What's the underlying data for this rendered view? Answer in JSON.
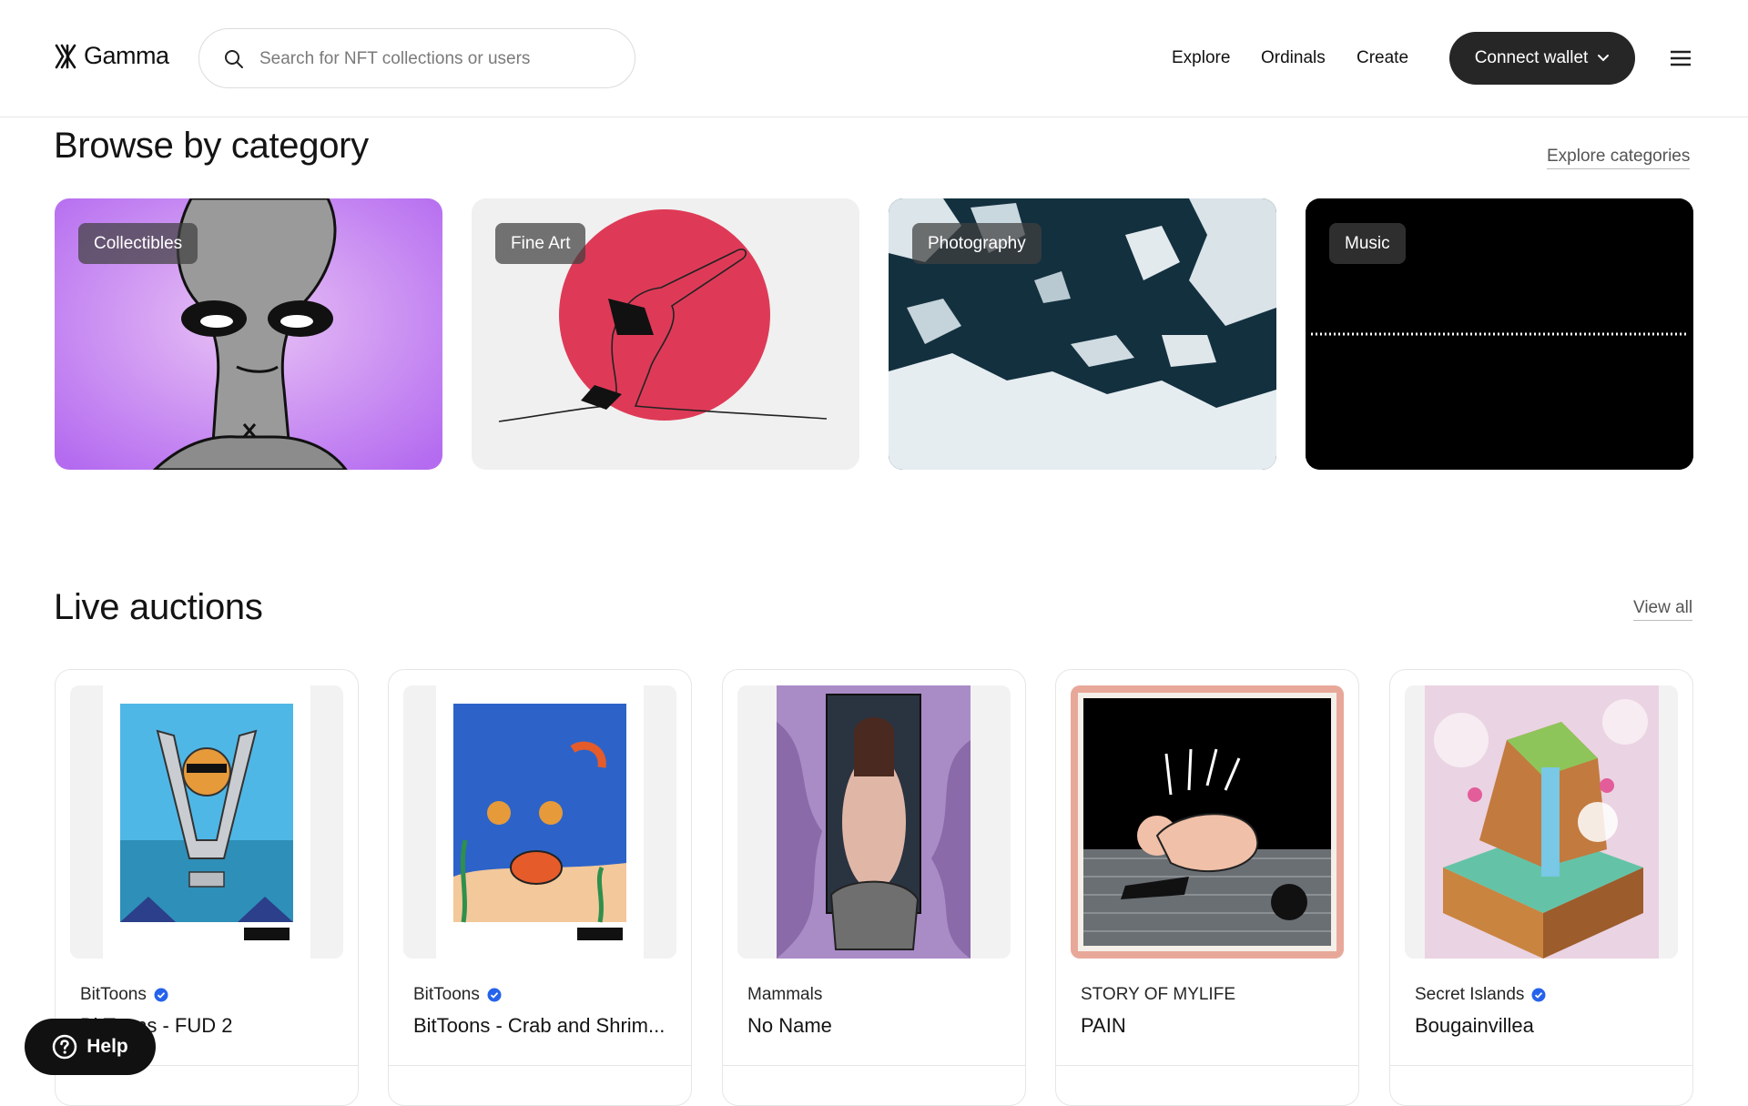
{
  "header": {
    "logo_text": "Gamma",
    "search": {
      "placeholder": "Search for NFT collections or users",
      "value": ""
    },
    "nav": [
      {
        "label": "Explore"
      },
      {
        "label": "Ordinals"
      },
      {
        "label": "Create"
      }
    ],
    "connect_label": "Connect wallet"
  },
  "categories": {
    "title": "Browse by category",
    "link": "Explore categories",
    "items": [
      {
        "label": "Collectibles"
      },
      {
        "label": "Fine Art"
      },
      {
        "label": "Photography"
      },
      {
        "label": "Music"
      }
    ]
  },
  "auctions": {
    "title": "Live auctions",
    "link": "View all",
    "items": [
      {
        "collection": "BitToons",
        "verified": true,
        "name": "BitToons - FUD 2"
      },
      {
        "collection": "BitToons",
        "verified": true,
        "name": "BitToons - Crab and Shrim..."
      },
      {
        "collection": "Mammals",
        "verified": false,
        "name": "No Name"
      },
      {
        "collection": "STORY OF MYLIFE",
        "verified": false,
        "name": "PAIN"
      },
      {
        "collection": "Secret Islands",
        "verified": true,
        "name": "Bougainvillea"
      }
    ]
  },
  "help_label": "Help",
  "colors": {
    "accent_dark": "#262626",
    "verified_blue": "#2563eb"
  }
}
